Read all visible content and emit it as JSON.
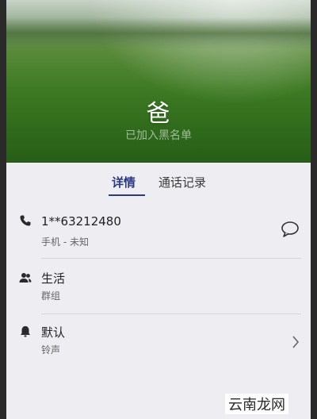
{
  "contact": {
    "name": "爸",
    "status_note": "已加入黑名单"
  },
  "tabs": [
    {
      "label": "详情",
      "active": true
    },
    {
      "label": "通话记录",
      "active": false
    }
  ],
  "rows": {
    "phone": {
      "title": "1**63212480",
      "subtitle": "手机 - 未知",
      "icon": "phone-icon",
      "action_icon": "message-bubble-icon"
    },
    "group": {
      "title": "生活",
      "subtitle": "群组",
      "icon": "group-icon"
    },
    "ringtone": {
      "title": "默认",
      "subtitle": "铃声",
      "icon": "bell-icon",
      "action_icon": "chevron-right-icon"
    }
  },
  "watermark": "云南龙网",
  "colors": {
    "accent": "#2c3a86",
    "background": "#eeedf1"
  }
}
